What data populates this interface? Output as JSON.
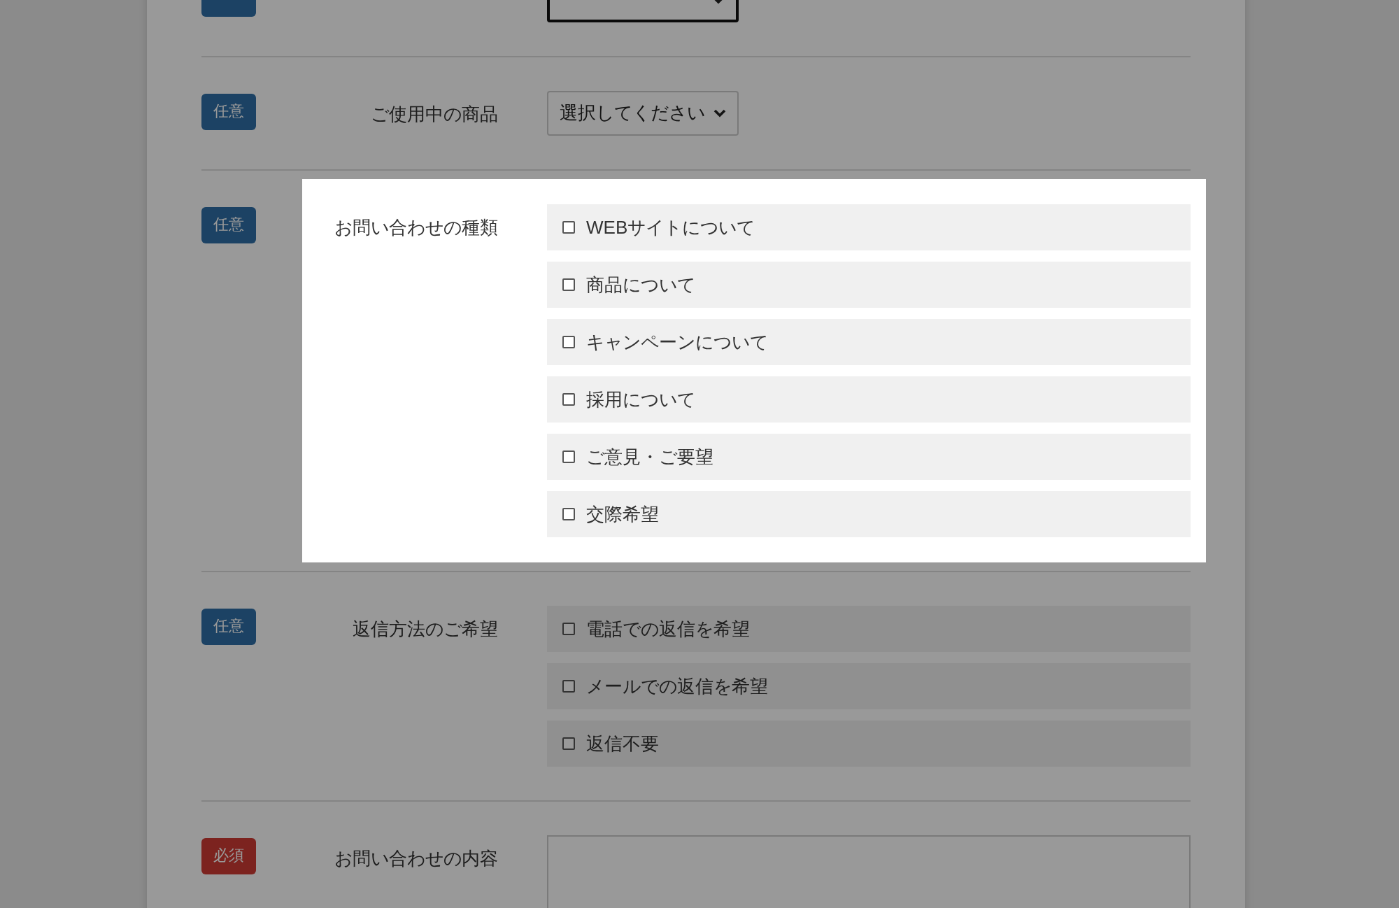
{
  "sections": [
    {
      "badge": {
        "kind": "optional"
      },
      "highlighted": false,
      "control": {
        "kind": "select",
        "focused": true
      }
    },
    {
      "badge": {
        "text": "任意",
        "kind": "optional"
      },
      "label": "ご使用中の商品",
      "highlighted": false,
      "control": {
        "kind": "select",
        "value": "選択してください",
        "focused": false
      }
    },
    {
      "badge": {
        "text": "任意",
        "kind": "optional"
      },
      "label": "お問い合わせの種類",
      "highlighted": true,
      "control": {
        "kind": "checkboxes",
        "options": [
          {
            "label": "WEBサイトについて",
            "checked": false
          },
          {
            "label": "商品について",
            "checked": false
          },
          {
            "label": "キャンペーンについて",
            "checked": false
          },
          {
            "label": "採用について",
            "checked": false
          },
          {
            "label": "ご意見・ご要望",
            "checked": false
          },
          {
            "label": "交際希望",
            "checked": false
          }
        ]
      }
    },
    {
      "badge": {
        "text": "任意",
        "kind": "optional"
      },
      "label": "返信方法のご希望",
      "highlighted": false,
      "control": {
        "kind": "checkboxes",
        "options": [
          {
            "label": "電話での返信を希望",
            "checked": false
          },
          {
            "label": "メールでの返信を希望",
            "checked": false
          },
          {
            "label": "返信不要",
            "checked": false
          }
        ]
      }
    },
    {
      "badge": {
        "text": "必須",
        "kind": "required"
      },
      "label": "お問い合わせの内容",
      "highlighted": false,
      "control": {
        "kind": "textarea"
      }
    }
  ]
}
